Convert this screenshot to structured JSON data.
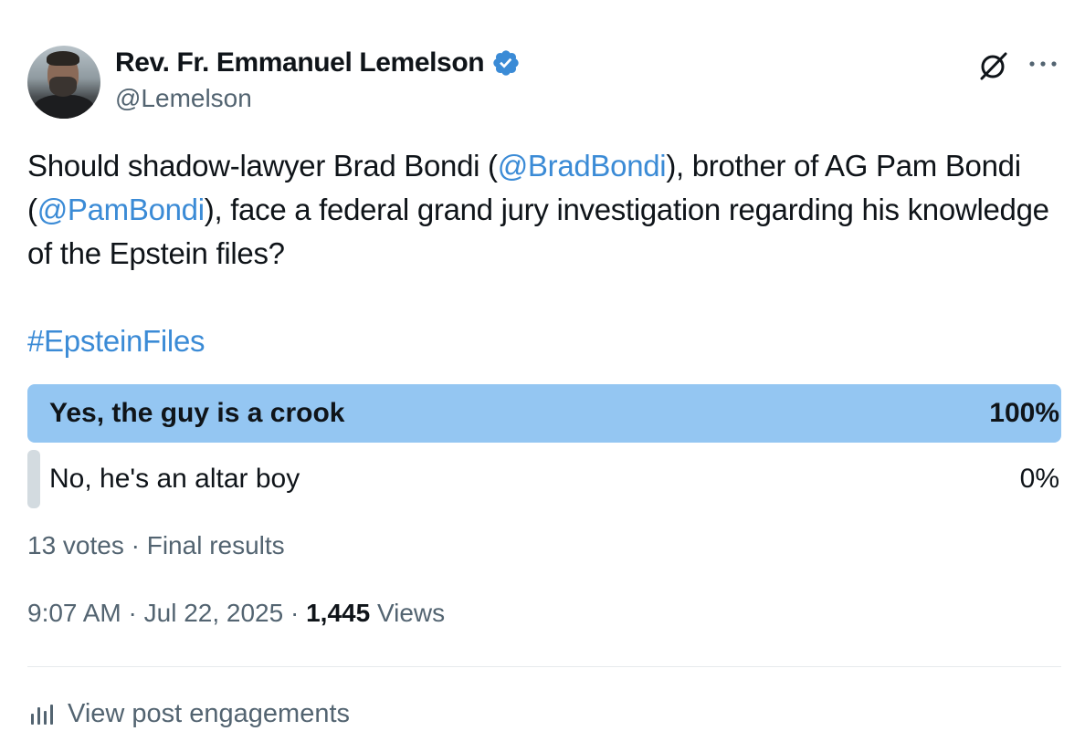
{
  "author": {
    "display_name": "Rev. Fr. Emmanuel Lemelson",
    "handle": "@Lemelson",
    "verified_icon": "verified-badge-icon",
    "verified_color": "#3b8bd6"
  },
  "post": {
    "text_1": "Should shadow-lawyer Brad Bondi (",
    "mention_1": "@BradBondi",
    "text_2": "), brother of AG Pam Bondi (",
    "mention_2": "@PamBondi",
    "text_3": "), face a federal grand jury investigation regarding his knowledge of the Epstein files?",
    "hashtag": "#EpsteinFiles"
  },
  "poll": {
    "options": [
      {
        "label": "Yes, the guy is a crook",
        "percent_label": "100%",
        "percent": 100
      },
      {
        "label": "No, he's an altar boy",
        "percent_label": "0%",
        "percent": 0
      }
    ],
    "meta": "13 votes · Final results",
    "winner_color": "#94c6f2",
    "loser_color": "#d3dbe0"
  },
  "stats": {
    "time": "9:07 AM",
    "sep_1": " · ",
    "date": "Jul 22, 2025",
    "sep_2": " · ",
    "views_count": "1,445",
    "views_label": " Views"
  },
  "actions": {
    "engagements_label": "View post engagements",
    "engagements_icon": "bar-chart-icon",
    "grok_icon": "grok-icon",
    "more_icon": "more-options-icon"
  },
  "colors": {
    "text": "#0f1419",
    "secondary": "#536471",
    "link": "#3b8bd6"
  }
}
